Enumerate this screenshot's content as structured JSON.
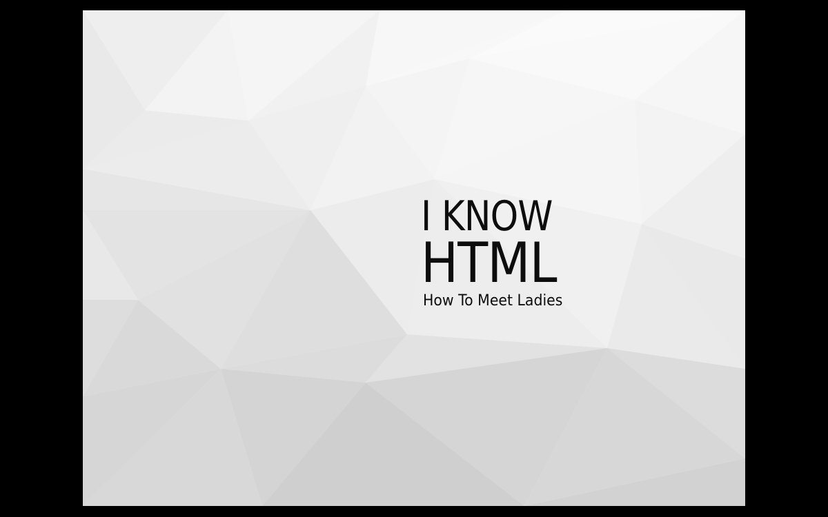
{
  "slide": {
    "title_line1": "I KNOW",
    "title_line2": "HTML",
    "subtitle": "How To Meet Ladies"
  },
  "colors": {
    "frame": "#000000",
    "text": "#0d0d0d",
    "background": "#f2f2f2"
  }
}
